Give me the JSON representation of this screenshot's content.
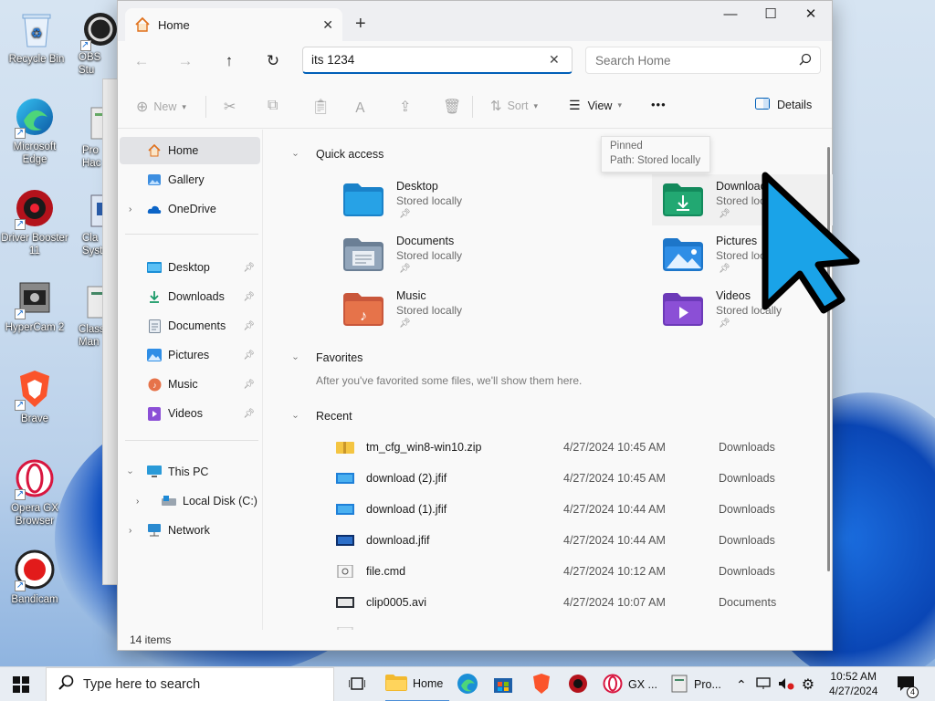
{
  "desktop": {
    "icons": [
      {
        "label": "Recycle Bin",
        "icon": "recycle-bin-icon"
      },
      {
        "label": "OBS Stu",
        "icon": "obs-icon"
      },
      {
        "label": "Microsoft Edge",
        "icon": "edge-icon"
      },
      {
        "label": "Pro Hac",
        "icon": "process-hacker-icon"
      },
      {
        "label": "Driver Booster 11",
        "icon": "driver-booster-icon"
      },
      {
        "label": "Cla Syster",
        "icon": "system-app-icon"
      },
      {
        "label": "HyperCam 2",
        "icon": "hypercam-icon"
      },
      {
        "label": "Class Man",
        "icon": "classic-manager-icon"
      },
      {
        "label": "Brave",
        "icon": "brave-icon"
      },
      {
        "label": "Opera GX Browser",
        "icon": "opera-gx-icon"
      },
      {
        "label": "Bandicam",
        "icon": "bandicam-icon"
      }
    ]
  },
  "window": {
    "tab_label": "Home",
    "tab_close": "✕",
    "new_tab": "+",
    "minimize": "—",
    "maximize": "☐",
    "close": "✕",
    "address_value": "its 1234",
    "address_clear": "✕",
    "search_placeholder": "Search Home"
  },
  "toolbar": {
    "new_label": "New",
    "sort_label": "Sort",
    "view_label": "View",
    "more_label": "•••",
    "details_label": "Details"
  },
  "nav": {
    "home": "Home",
    "gallery": "Gallery",
    "onedrive": "OneDrive",
    "pinned": [
      "Desktop",
      "Downloads",
      "Documents",
      "Pictures",
      "Music",
      "Videos"
    ],
    "this_pc": "This PC",
    "local_disk": "Local Disk (C:)",
    "network": "Network"
  },
  "quick_access": {
    "header": "Quick access",
    "items": [
      {
        "name": "Desktop",
        "sub": "Stored locally"
      },
      {
        "name": "Downloads",
        "sub": "Stored locally"
      },
      {
        "name": "Documents",
        "sub": "Stored locally"
      },
      {
        "name": "Pictures",
        "sub": "Stored locally"
      },
      {
        "name": "Music",
        "sub": "Stored locally"
      },
      {
        "name": "Videos",
        "sub": "Stored locally"
      }
    ]
  },
  "tooltip": {
    "line1": "Pinned",
    "line2": "Path: Stored locally"
  },
  "favorites": {
    "header": "Favorites",
    "empty_text": "After you've favorited some files, we'll show them here."
  },
  "recent": {
    "header": "Recent",
    "rows": [
      {
        "name": "tm_cfg_win8-win10.zip",
        "date": "4/27/2024 10:45 AM",
        "location": "Downloads"
      },
      {
        "name": "download (2).jfif",
        "date": "4/27/2024 10:45 AM",
        "location": "Downloads"
      },
      {
        "name": "download (1).jfif",
        "date": "4/27/2024 10:44 AM",
        "location": "Downloads"
      },
      {
        "name": "download.jfif",
        "date": "4/27/2024 10:44 AM",
        "location": "Downloads"
      },
      {
        "name": "file.cmd",
        "date": "4/27/2024 10:12 AM",
        "location": "Downloads"
      },
      {
        "name": "clip0005.avi",
        "date": "4/27/2024 10:07 AM",
        "location": "Documents"
      }
    ]
  },
  "status": {
    "items_count": "14 items"
  },
  "taskbar": {
    "search_placeholder": "Type here to search",
    "explorer_label": "Home",
    "opera_label": "GX ...",
    "pro_label": "Pro...",
    "time": "10:52 AM",
    "date": "4/27/2024",
    "notifications": "4"
  },
  "colors": {
    "accent": "#005fb8",
    "cursor": "#1aa3e8"
  }
}
